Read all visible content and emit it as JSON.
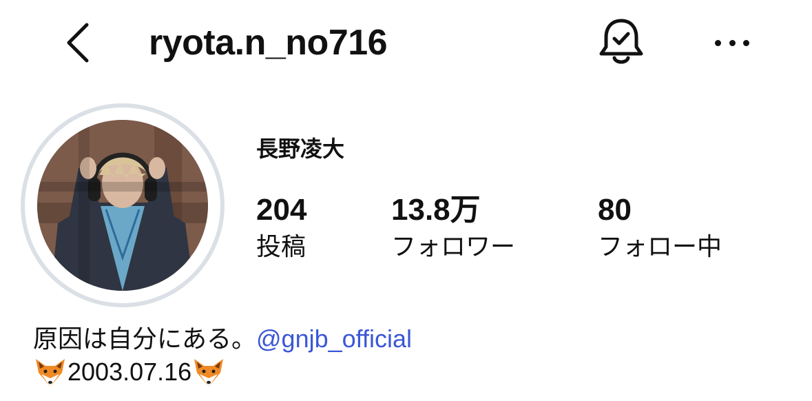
{
  "header": {
    "username": "ryota.n_no716",
    "back_icon": "chevron-left-icon",
    "notifications_icon": "bell-check-icon",
    "more_icon": "more-horizontal-icon"
  },
  "profile": {
    "full_name": "長野凌大",
    "avatar_ring_color": "#dbe0e6"
  },
  "stats": {
    "posts": {
      "value": "204",
      "label": "投稿"
    },
    "followers": {
      "value": "13.8万",
      "label": "フォロワー"
    },
    "following": {
      "value": "80",
      "label": "フォロー中"
    }
  },
  "bio": {
    "text": "原因は自分にある。",
    "mention": "@gnjb_official",
    "mention_color": "#3a57d6",
    "birthday": "2003.07.16",
    "emoji_icon": "fox-face-icon"
  }
}
